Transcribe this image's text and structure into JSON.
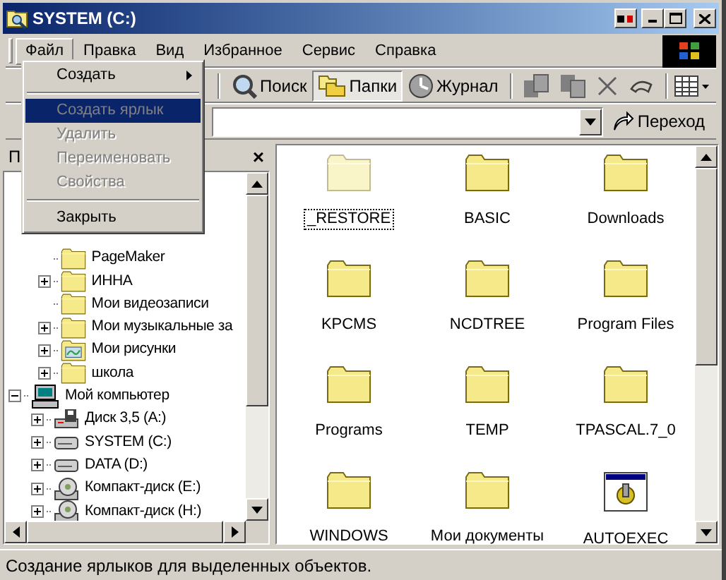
{
  "window": {
    "title": "SYSTEM (C:)"
  },
  "menu_bar": [
    {
      "label": "Файл",
      "selected": true
    },
    {
      "label": "Правка",
      "selected": false
    },
    {
      "label": "Вид",
      "selected": false
    },
    {
      "label": "Избранное",
      "selected": false
    },
    {
      "label": "Сервис",
      "selected": false
    },
    {
      "label": "Справка",
      "selected": false
    }
  ],
  "file_menu": [
    {
      "kind": "item",
      "label": "Создать",
      "submenu": true,
      "disabled": false,
      "selected": false
    },
    {
      "kind": "separator"
    },
    {
      "kind": "item",
      "label": "Создать ярлык",
      "submenu": false,
      "disabled": true,
      "selected": true
    },
    {
      "kind": "item",
      "label": "Удалить",
      "submenu": false,
      "disabled": true,
      "selected": false
    },
    {
      "kind": "item",
      "label": "Переименовать",
      "submenu": false,
      "disabled": true,
      "selected": false
    },
    {
      "kind": "item",
      "label": "Свойства",
      "submenu": false,
      "disabled": true,
      "selected": false
    },
    {
      "kind": "separator"
    },
    {
      "kind": "item",
      "label": "Закрыть",
      "submenu": false,
      "disabled": false,
      "selected": false
    }
  ],
  "toolbar": [
    {
      "kind": "search",
      "label": "Поиск",
      "pressed": false
    },
    {
      "kind": "folders",
      "label": "Папки",
      "pressed": true
    },
    {
      "kind": "history",
      "label": "Журнал",
      "pressed": false
    }
  ],
  "address_bar": {
    "go_label": "Переход"
  },
  "folders_pane": {
    "title": "П",
    "close": "×"
  },
  "tree": [
    {
      "children": [
        {
          "label": "PageMaker",
          "kind": "folder",
          "expandable": false
        },
        {
          "label": "ИННА",
          "kind": "folder",
          "expandable": true
        },
        {
          "label": "Мои видеозаписи",
          "kind": "folder",
          "expandable": false
        },
        {
          "label": "Мои музыкальные за",
          "kind": "folder",
          "expandable": true
        },
        {
          "label": "Мои рисунки",
          "kind": "pictures",
          "expandable": true
        },
        {
          "label": "школа",
          "kind": "folder",
          "expandable": true
        }
      ]
    },
    {
      "label": "Мой компьютер",
      "kind": "computer",
      "expanded": true,
      "children": [
        {
          "label": "Диск 3,5 (A:)",
          "kind": "floppy",
          "expandable": true
        },
        {
          "label": "SYSTEM (C:)",
          "kind": "drive",
          "expandable": true
        },
        {
          "label": "DATA (D:)",
          "kind": "drive",
          "expandable": true
        },
        {
          "label": "Компакт-диск (E:)",
          "kind": "cd",
          "expandable": true
        },
        {
          "label": "Компакт-диск (H:)",
          "kind": "cd",
          "expandable": true
        }
      ]
    }
  ],
  "files": [
    {
      "name": "_RESTORE",
      "kind": "folder",
      "faded": true,
      "focused": true
    },
    {
      "name": "BASIC",
      "kind": "folder",
      "faded": false,
      "focused": false
    },
    {
      "name": "Downloads",
      "kind": "folder",
      "faded": false,
      "focused": false
    },
    {
      "name": "KPCMS",
      "kind": "folder",
      "faded": false,
      "focused": false
    },
    {
      "name": "NCDTREE",
      "kind": "folder",
      "faded": false,
      "focused": false
    },
    {
      "name": "Program Files",
      "kind": "folder",
      "faded": false,
      "focused": false
    },
    {
      "name": "Programs",
      "kind": "folder",
      "faded": false,
      "focused": false
    },
    {
      "name": "TEMP",
      "kind": "folder",
      "faded": false,
      "focused": false
    },
    {
      "name": "TPASCAL.7_0",
      "kind": "folder",
      "faded": false,
      "focused": false
    },
    {
      "name": "WINDOWS",
      "kind": "folder",
      "faded": false,
      "focused": false
    },
    {
      "name": "Мои документы",
      "kind": "folder",
      "faded": false,
      "focused": false
    },
    {
      "name": "AUTOEXEC",
      "kind": "program",
      "faded": false,
      "focused": false
    }
  ],
  "status_bar": "Создание ярлыков для выделенных объектов."
}
